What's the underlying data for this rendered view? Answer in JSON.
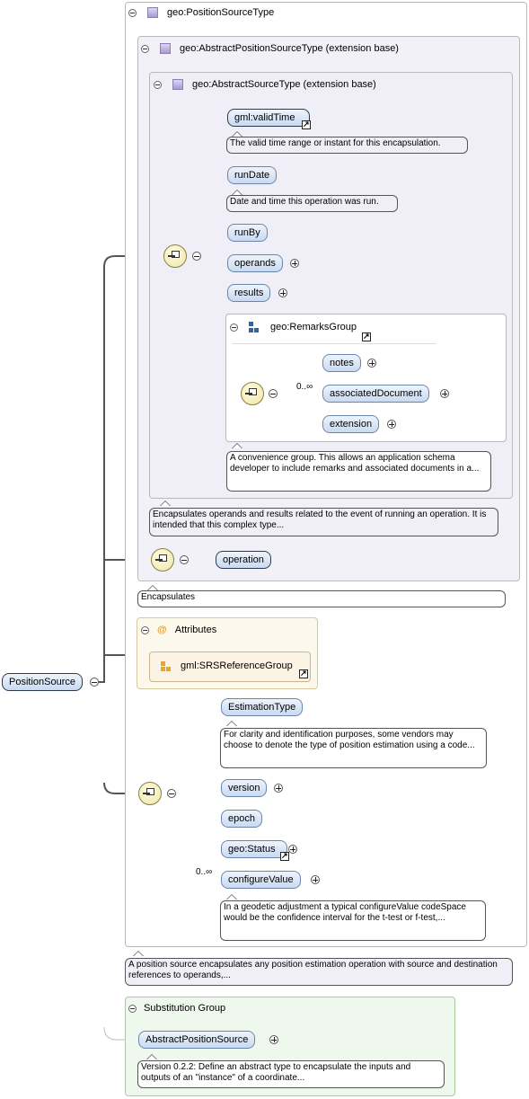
{
  "root": {
    "name": "PositionSource"
  },
  "outer_type": {
    "title": "geo:PositionSourceType"
  },
  "abstract_position": {
    "title": "geo:AbstractPositionSourceType (extension base)"
  },
  "abstract_source": {
    "title": "geo:AbstractSourceType (extension base)"
  },
  "elements": {
    "validTime": "gml:validTime",
    "validTime_doc": "The valid time range or instant for this encapsulation.",
    "runDate": "runDate",
    "runDate_doc": "Date and time this operation was run.",
    "runBy": "runBy",
    "operands": "operands",
    "results": "results",
    "operation": "operation",
    "estimationType": "EstimationType",
    "estimationType_doc": "For clarity and identification purposes, some vendors may choose to denote the type of position estimation using a code...",
    "version": "version",
    "epoch": "epoch",
    "status": "geo:Status",
    "configureValue": "configureValue",
    "configureValue_doc": "In a geodetic adjustment a typical configureValue codeSpace would be the confidence interval for the t-test or f-test,..."
  },
  "remarks_group": {
    "title": "geo:RemarksGroup",
    "occurrence": "0..∞",
    "notes": "notes",
    "associatedDocument": "associatedDocument",
    "extension": "extension",
    "doc": "A convenience group. This allows an application schema developer to include remarks and associated documents in a..."
  },
  "abstract_source_doc": "Encapsulates operands and results related to the event of running an operation. It is intended that this complex type...",
  "abstract_position_doc": "Encapsulates",
  "attributes": {
    "title": "Attributes",
    "icon": "@",
    "group": "gml:SRSReferenceGroup"
  },
  "configure_occurrence": "0..∞",
  "position_source_doc": "A position source encapsulates any position estimation operation with source and destination references to operands,...",
  "substitution": {
    "title": "Substitution Group",
    "member": "AbstractPositionSource",
    "doc": "Version 0.2.2: Define an abstract type to encapsulate the inputs and outputs of an \"instance\" of a coordinate..."
  },
  "colors": {
    "element_fill": "#c9daf1",
    "type_frame": "#f3f1f8",
    "attributes_fill": "#fdf8ec",
    "substitution_fill": "#eef8ec",
    "compositor_fill": "#efe6a8"
  }
}
